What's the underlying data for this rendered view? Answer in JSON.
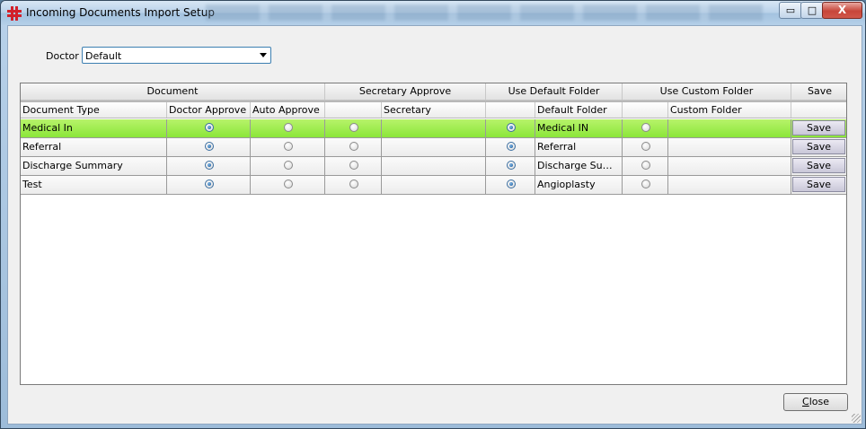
{
  "window": {
    "title": "Incoming Documents Import Setup",
    "min_glyph": "▭",
    "max_glyph": "□",
    "close_glyph": "X"
  },
  "doctor": {
    "label": "Doctor",
    "selected": "Default"
  },
  "grid": {
    "group_headers": [
      "Document",
      "Secretary Approve",
      "Use Default Folder",
      "Use Custom Folder",
      "Save"
    ],
    "columns": [
      "Document Type",
      "Doctor Approve",
      "Auto Approve",
      "",
      "Secretary",
      "",
      "Default Folder",
      "",
      "Custom Folder",
      ""
    ],
    "rows": [
      {
        "document_type": "Medical In",
        "doctor_approve": true,
        "auto_approve": false,
        "secretary_approve": false,
        "secretary": "",
        "use_default_folder": true,
        "default_folder": "Medical IN",
        "use_custom_folder": false,
        "custom_folder": "",
        "save_label": "Save",
        "selected": true
      },
      {
        "document_type": "Referral",
        "doctor_approve": true,
        "auto_approve": false,
        "secretary_approve": false,
        "secretary": "",
        "use_default_folder": true,
        "default_folder": "Referral",
        "use_custom_folder": false,
        "custom_folder": "",
        "save_label": "Save",
        "selected": false
      },
      {
        "document_type": "Discharge Summary",
        "doctor_approve": true,
        "auto_approve": false,
        "secretary_approve": false,
        "secretary": "",
        "use_default_folder": true,
        "default_folder": "Discharge Summ...",
        "use_custom_folder": false,
        "custom_folder": "",
        "save_label": "Save",
        "selected": false
      },
      {
        "document_type": "Test",
        "doctor_approve": true,
        "auto_approve": false,
        "secretary_approve": false,
        "secretary": "",
        "use_default_folder": true,
        "default_folder": "Angioplasty",
        "use_custom_folder": false,
        "custom_folder": "",
        "save_label": "Save",
        "selected": false
      }
    ]
  },
  "footer": {
    "close_label": "Close",
    "close_mnemonic": "C",
    "close_rest": "lose"
  },
  "colors": {
    "selected_row": "#9cec4c",
    "radio_selected": "#1d5a9a"
  }
}
